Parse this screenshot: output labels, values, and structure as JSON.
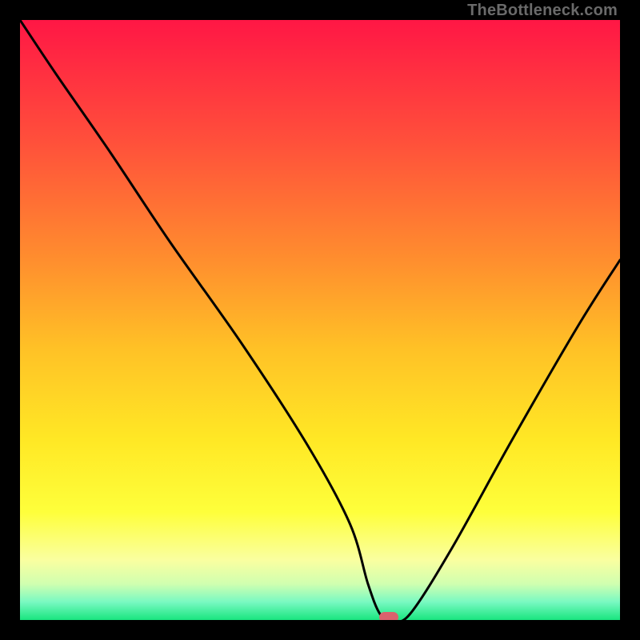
{
  "watermark": "TheBottleneck.com",
  "chart_data": {
    "type": "line",
    "title": "",
    "xlabel": "",
    "ylabel": "",
    "xlim": [
      0,
      100
    ],
    "ylim": [
      0,
      100
    ],
    "background_gradient": {
      "direction": "vertical",
      "stops": [
        {
          "pos": 0.0,
          "color": "#ff1745"
        },
        {
          "pos": 0.2,
          "color": "#ff4f3b"
        },
        {
          "pos": 0.4,
          "color": "#ff8e2e"
        },
        {
          "pos": 0.55,
          "color": "#ffc226"
        },
        {
          "pos": 0.7,
          "color": "#ffe825"
        },
        {
          "pos": 0.82,
          "color": "#feff3b"
        },
        {
          "pos": 0.9,
          "color": "#faffa0"
        },
        {
          "pos": 0.94,
          "color": "#d0ffb0"
        },
        {
          "pos": 0.97,
          "color": "#79f9c2"
        },
        {
          "pos": 1.0,
          "color": "#19e57e"
        }
      ]
    },
    "series": [
      {
        "name": "bottleneck-curve",
        "x": [
          0,
          6,
          15,
          25,
          37,
          48,
          55,
          58,
          60,
          62,
          65,
          72,
          82,
          93,
          100
        ],
        "values": [
          100,
          91,
          78,
          63,
          46,
          29,
          16,
          6,
          1,
          0,
          1,
          12,
          30,
          49,
          60
        ]
      }
    ],
    "marker": {
      "x": 61.5,
      "y": 0.5,
      "color": "#d9626d"
    }
  }
}
